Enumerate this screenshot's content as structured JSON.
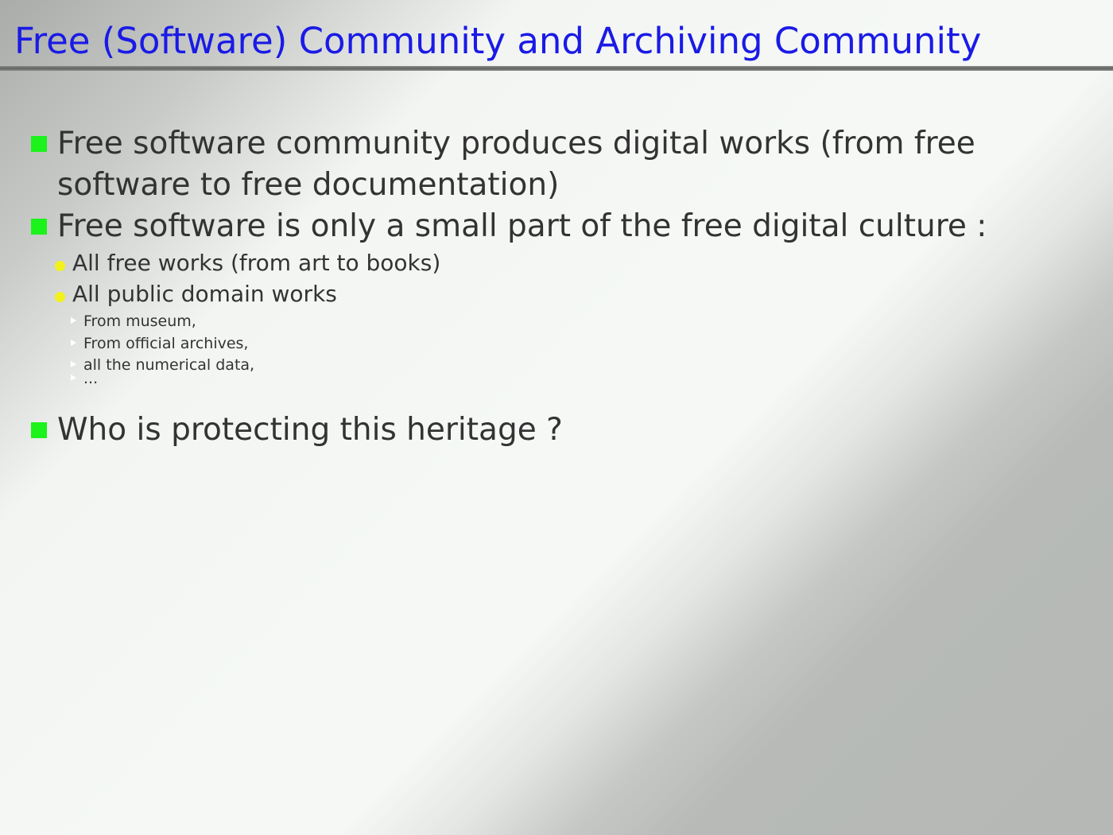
{
  "slide": {
    "title": "Free (Software) Community and Archiving Community",
    "bullets": {
      "b1": "Free software community produces digital works (from free software to free documentation)",
      "b2": "Free software is only a small part of the free digital culture :",
      "b2_sub1": "All free works (from art to books)",
      "b2_sub2": "All public domain works",
      "b2_sub2_items": [
        "From museum,",
        "From official archives,",
        "all the numerical data,",
        "..."
      ],
      "b3": "Who is protecting this heritage ?"
    },
    "colors": {
      "title": "#1a1ae6",
      "level1_marker": "#1cf21c",
      "level2_marker": "#f2f21c",
      "text": "#333333"
    },
    "icons": {
      "level1": "green-square-bullet",
      "level2": "yellow-dot-bullet",
      "level3": "white-triangle-bullet"
    }
  }
}
